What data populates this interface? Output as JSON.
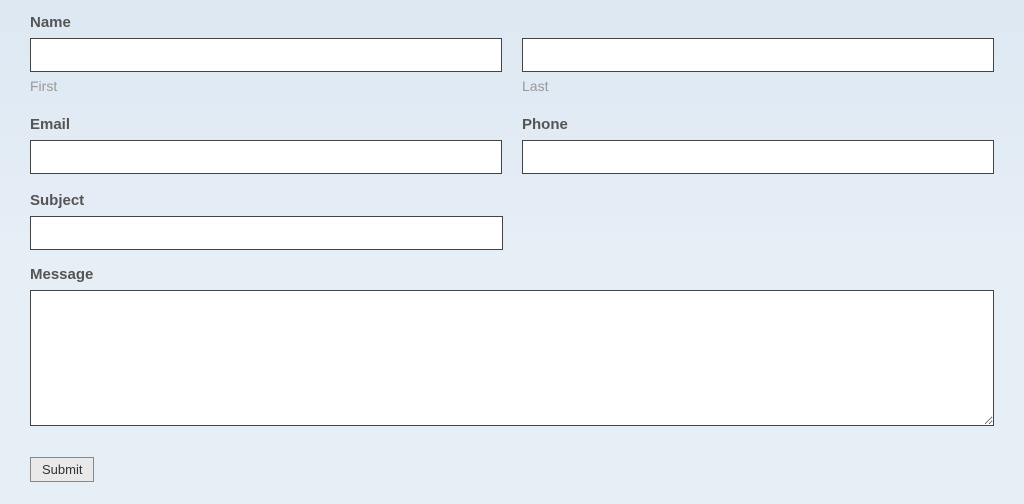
{
  "form": {
    "name": {
      "label": "Name",
      "first_sub": "First",
      "last_sub": "Last",
      "first_value": "",
      "last_value": ""
    },
    "email": {
      "label": "Email",
      "value": ""
    },
    "phone": {
      "label": "Phone",
      "value": ""
    },
    "subject": {
      "label": "Subject",
      "value": ""
    },
    "message": {
      "label": "Message",
      "value": ""
    },
    "submit_label": "Submit"
  }
}
